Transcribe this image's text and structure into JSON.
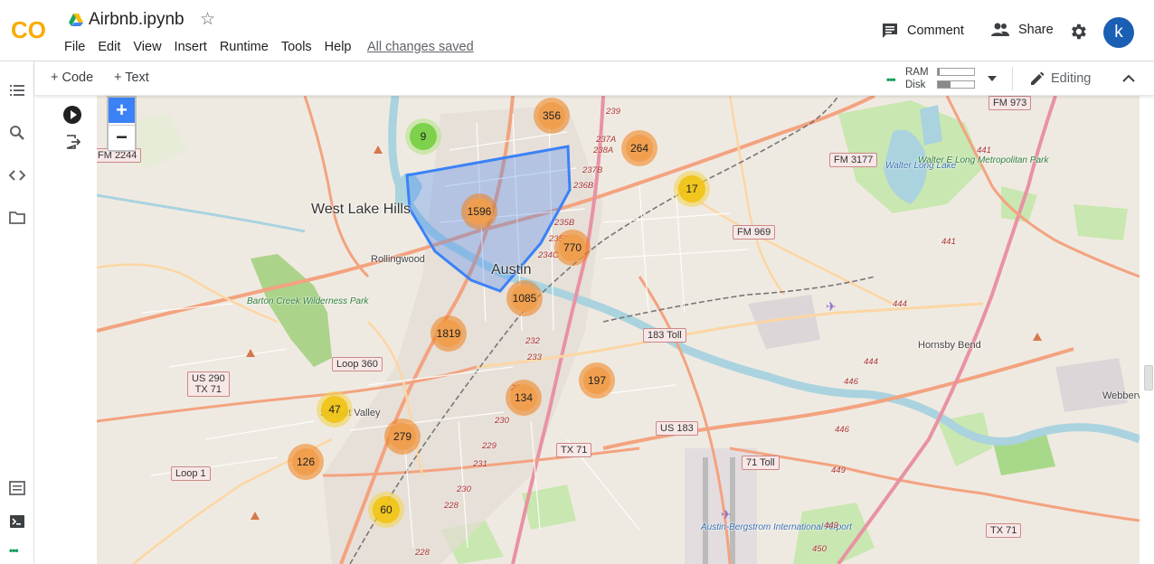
{
  "header": {
    "notebook_title": "Airbnb.ipynb",
    "menu": [
      "File",
      "Edit",
      "View",
      "Insert",
      "Runtime",
      "Tools",
      "Help"
    ],
    "save_status": "All changes saved",
    "comment_label": "Comment",
    "share_label": "Share",
    "avatar_letter": "k",
    "logo_text": "CO"
  },
  "toolbar": {
    "code_label": "+ Code",
    "text_label": "+ Text",
    "ram_label": "RAM",
    "disk_label": "Disk",
    "ram_usage": 0.05,
    "disk_usage": 0.35,
    "editing_label": "Editing"
  },
  "colors": {
    "cluster_large": "#f0a04d",
    "cluster_medium": "#f0c20c",
    "cluster_small": "#6ecc39",
    "polygon": "#3b82f6",
    "avatar": "#1a5fb4"
  },
  "map": {
    "zoom_in": "+",
    "zoom_out": "−",
    "clusters": [
      {
        "count": "9",
        "size": "small"
      },
      {
        "count": "356",
        "size": "large"
      },
      {
        "count": "264",
        "size": "large"
      },
      {
        "count": "17",
        "size": "medium"
      },
      {
        "count": "1596",
        "size": "large"
      },
      {
        "count": "770",
        "size": "large"
      },
      {
        "count": "1085",
        "size": "large"
      },
      {
        "count": "1819",
        "size": "large"
      },
      {
        "count": "197",
        "size": "large"
      },
      {
        "count": "134",
        "size": "large"
      },
      {
        "count": "47",
        "size": "medium"
      },
      {
        "count": "279",
        "size": "large"
      },
      {
        "count": "126",
        "size": "large"
      },
      {
        "count": "60",
        "size": "medium"
      }
    ],
    "places": {
      "west_lake_hills": "West Lake Hills",
      "rollingwood": "Rollingwood",
      "austin": "Austin",
      "barton_creek": "Barton Creek Wilderness Park",
      "sunset_valley": "Sunset Valley",
      "hornsby_bend": "Hornsby Bend",
      "webberville": "Webberv",
      "walter_long_lake": "Walter Long Lake",
      "walter_long_park": "Walter E Long Metropolitan Park",
      "airport": "Austin-Bergstrom International Airport"
    },
    "shields": {
      "fm2244": "FM 2244",
      "fm973": "FM 973",
      "fm3177": "FM 3177",
      "fm969": "FM 969",
      "toll183": "183 Toll",
      "loop360": "Loop 360",
      "us290": "US 290",
      "tx71": "TX 71",
      "us183": "US 183",
      "toll71": "71 Toll",
      "loop1": "Loop 1"
    },
    "route_numbers": [
      "239",
      "237A",
      "238A",
      "237B",
      "236B",
      "235B",
      "235B",
      "234C",
      "232",
      "233",
      "231",
      "230",
      "229",
      "231",
      "230",
      "228",
      "228",
      "441",
      "441",
      "444",
      "444",
      "446",
      "446",
      "449",
      "449",
      "450"
    ]
  }
}
